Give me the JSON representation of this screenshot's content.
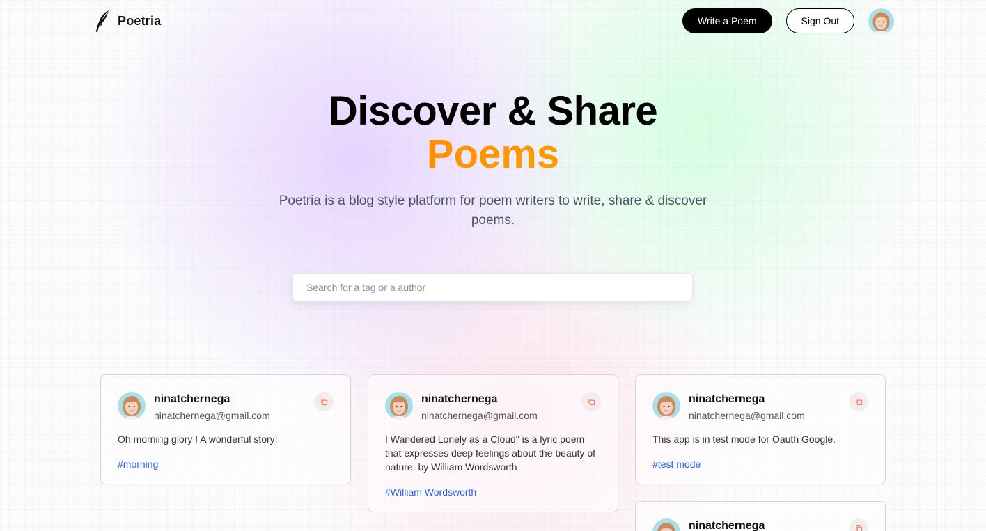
{
  "nav": {
    "brand": "Poetria",
    "write_button": "Write a Poem",
    "signout_button": "Sign Out"
  },
  "hero": {
    "title_line1": "Discover & Share",
    "title_line2": "Poems",
    "description": "Poetria is a blog style platform for poem writers to write, share & discover poems."
  },
  "search": {
    "placeholder": "Search for a tag or a author",
    "value": ""
  },
  "posts": [
    {
      "username": "ninatchernega",
      "email": "ninatchernega@gmail.com",
      "text": "Oh morning glory ! A wonderful story!",
      "tag": "#morning"
    },
    {
      "username": "ninatchernega",
      "email": "ninatchernega@gmail.com",
      "text": "I Wandered Lonely as a Cloud\" is a lyric poem that expresses deep feelings about the beauty of nature. by William Wordsworth",
      "tag": "#William Wordsworth"
    },
    {
      "username": "ninatchernega",
      "email": "ninatchernega@gmail.com",
      "text": "This app is in test mode for Oauth Google.",
      "tag": "#test mode"
    },
    {
      "username": "ninatchernega"
    }
  ],
  "colors": {
    "primary": "#000000",
    "accent_start": "#ff6a00",
    "accent_end": "#f5b800",
    "tag": "#2563eb",
    "copy_icon": "#ff7a59"
  },
  "icons": {
    "brand": "quill-icon",
    "copy": "copy-icon"
  }
}
